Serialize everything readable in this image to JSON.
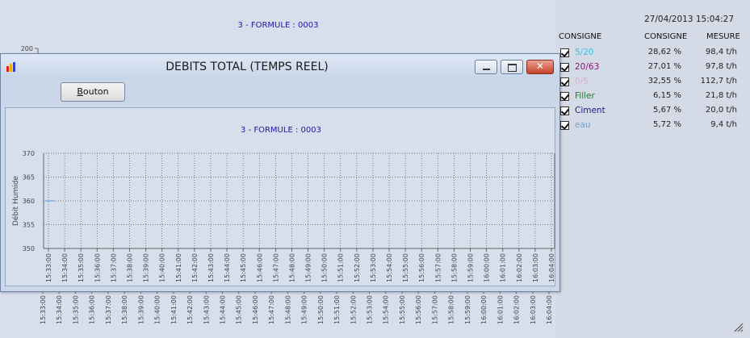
{
  "background_chart": {
    "title": "3 - FORMULE : 0003",
    "y_top_tick": "200"
  },
  "dialog": {
    "title": "DEBITS TOTAL (TEMPS REEL)",
    "button_label": "Bouton",
    "button_mnemonic": "B",
    "button_rest": "outon",
    "close_glyph": "✕"
  },
  "right_panel": {
    "datetime": "27/04/2013 15:04:27",
    "headers": {
      "name": "CONSIGNE",
      "consigne": "CONSIGNE",
      "mesure": "MESURE"
    },
    "rows": [
      {
        "name": "5/20",
        "color": "#33c3df",
        "consigne": "28,62 %",
        "mesure": "98,4 t/h",
        "checked": true
      },
      {
        "name": "20/63",
        "color": "#8b1a7a",
        "consigne": "27,01 %",
        "mesure": "97,8 t/h",
        "checked": true
      },
      {
        "name": "0/5",
        "color": "#e8a6cf",
        "consigne": "32,55 %",
        "mesure": "112,7 t/h",
        "checked": true
      },
      {
        "name": "Filler",
        "color": "#1f7f2a",
        "consigne": "6,15 %",
        "mesure": "21,8 t/h",
        "checked": true
      },
      {
        "name": "Ciment",
        "color": "#1a1a88",
        "consigne": "5,67 %",
        "mesure": "20,0 t/h",
        "checked": true
      },
      {
        "name": "eau",
        "color": "#6aa0d8",
        "consigne": "5,72 %",
        "mesure": "9,4 t/h",
        "checked": true
      }
    ]
  },
  "chart_data": {
    "type": "line",
    "title": "3 - FORMULE : 0003",
    "ylabel": "Débit Humide",
    "xlabel": "",
    "ylim": [
      350,
      370
    ],
    "yticks": [
      350,
      355,
      360,
      365,
      370
    ],
    "grid": true,
    "categories": [
      "15:33:00",
      "15:34:00",
      "15:35:00",
      "15:36:00",
      "15:37:00",
      "15:38:00",
      "15:39:00",
      "15:40:00",
      "15:41:00",
      "15:42:00",
      "15:43:00",
      "15:44:00",
      "15:45:00",
      "15:46:00",
      "15:47:00",
      "15:48:00",
      "15:49:00",
      "15:50:00",
      "15:51:00",
      "15:52:00",
      "15:53:00",
      "15:54:00",
      "15:55:00",
      "15:56:00",
      "15:57:00",
      "15:58:00",
      "15:59:00",
      "16:00:00",
      "16:01:00",
      "16:02:00",
      "16:03:00",
      "16:04:00"
    ],
    "series": [
      {
        "color": "#6aa0d8",
        "x": [
          "15:33:00"
        ],
        "values": [
          360
        ]
      }
    ]
  },
  "colors": {
    "title_blue": "#1a1aa0",
    "grid": "#555555",
    "axis": "#666666"
  }
}
